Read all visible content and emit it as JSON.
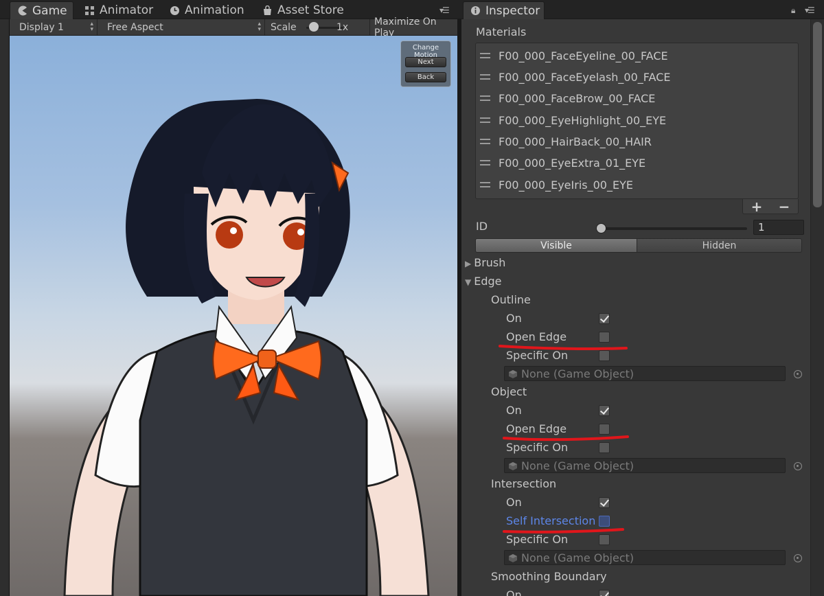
{
  "tabs": {
    "game": "Game",
    "animator": "Animator",
    "animation": "Animation",
    "asset_store": "Asset Store",
    "inspector": "Inspector"
  },
  "game_toolbar": {
    "display": "Display 1",
    "aspect": "Free Aspect",
    "scale_label": "Scale",
    "scale_value": "1x",
    "maximize": "Maximize On Play"
  },
  "motion_panel": {
    "title": "Change Motion",
    "next": "Next",
    "back": "Back"
  },
  "inspector": {
    "materials_label": "Materials",
    "materials": [
      "F00_000_FaceEyeline_00_FACE",
      "F00_000_FaceEyelash_00_FACE",
      "F00_000_FaceBrow_00_FACE",
      "F00_000_EyeHighlight_00_EYE",
      "F00_000_HairBack_00_HAIR",
      "F00_000_EyeExtra_01_EYE",
      "F00_000_EyeIris_00_EYE"
    ],
    "id_label": "ID",
    "id_value": "1",
    "visible": "Visible",
    "hidden": "Hidden",
    "brush": "Brush",
    "edge": "Edge",
    "outline": {
      "title": "Outline",
      "on": "On",
      "open_edge": "Open Edge",
      "specific_on": "Specific On",
      "object_none": "None (Game Object)"
    },
    "object": {
      "title": "Object",
      "on": "On",
      "open_edge": "Open Edge",
      "specific_on": "Specific On",
      "object_none": "None (Game Object)"
    },
    "intersection": {
      "title": "Intersection",
      "on": "On",
      "self_intersection": "Self Intersection",
      "specific_on": "Specific On",
      "object_none": "None (Game Object)"
    },
    "smoothing_boundary": {
      "title": "Smoothing Boundary",
      "on": "On"
    }
  },
  "colors": {
    "annotation_red": "#e0161b",
    "selected_label_blue": "#5d86e8"
  }
}
